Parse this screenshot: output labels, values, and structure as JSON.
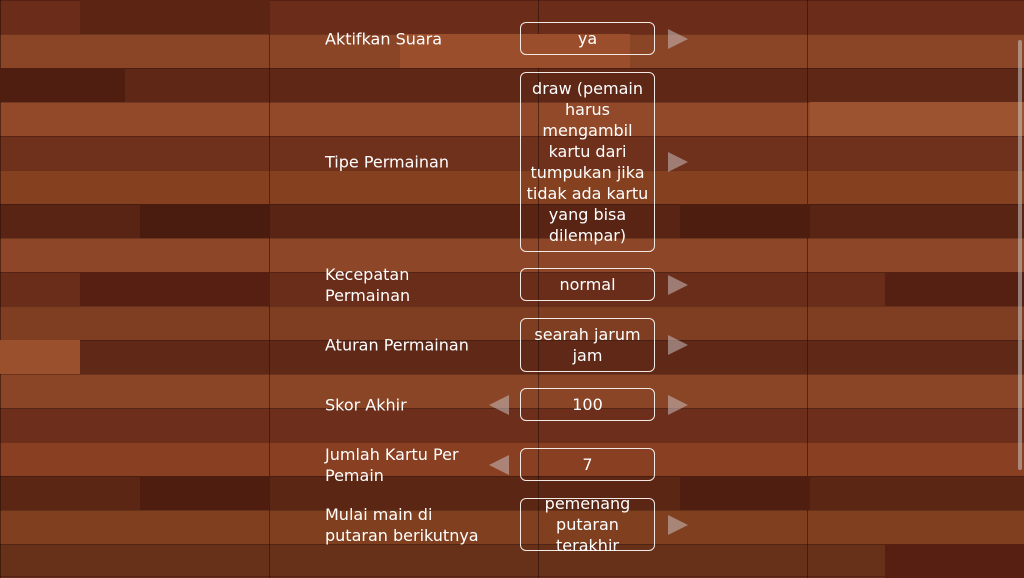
{
  "settings": [
    {
      "label": "Aktifkan Suara",
      "value": "ya",
      "left_arrow": false,
      "right_arrow": true
    },
    {
      "label": "Tipe Permainan",
      "value": "draw (pemain harus mengambil kartu dari tumpukan jika tidak ada kartu yang bisa dilempar)",
      "left_arrow": false,
      "right_arrow": true
    },
    {
      "label": "Kecepatan Permainan",
      "value": "normal",
      "left_arrow": false,
      "right_arrow": true
    },
    {
      "label": "Aturan Permainan",
      "value": "searah jarum jam",
      "left_arrow": false,
      "right_arrow": true
    },
    {
      "label": "Skor Akhir",
      "value": "100",
      "left_arrow": true,
      "right_arrow": true
    },
    {
      "label": "Jumlah Kartu Per Pemain",
      "value": "7",
      "left_arrow": true,
      "right_arrow": false
    },
    {
      "label": "Mulai main di putaran berikutnya",
      "value": "pemenang putaran terakhir",
      "left_arrow": false,
      "right_arrow": true
    }
  ],
  "colors": {
    "text": "#ffffff",
    "box_border": "#f2e9e4",
    "arrow": "#c8bebe",
    "background": "#7a3a22"
  },
  "icons": {
    "next": "triangle-right-icon",
    "prev": "triangle-left-icon"
  }
}
